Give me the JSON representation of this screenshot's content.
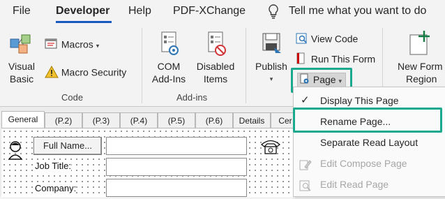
{
  "tabs": {
    "file": "File",
    "developer": "Developer",
    "help": "Help",
    "pdfxchange": "PDF-XChange",
    "tell_me": "Tell me what you want to do"
  },
  "ribbon": {
    "code": {
      "visual_basic": [
        "Visual",
        "Basic"
      ],
      "macros": "Macros",
      "macro_security": "Macro Security",
      "group_label": "Code"
    },
    "addins": {
      "com_addins": [
        "COM",
        "Add-Ins"
      ],
      "disabled_items": [
        "Disabled",
        "Items"
      ],
      "group_label": "Add-ins"
    },
    "custom_form": {
      "publish": "Publish",
      "view_code": "View Code",
      "run_this_form": "Run This Form",
      "page": "Page"
    },
    "new_form_region": [
      "New Form",
      "Region"
    ]
  },
  "page_menu": {
    "items": [
      {
        "label": "Display This Page",
        "checked": true,
        "enabled": true
      },
      {
        "label": "Rename Page...",
        "checked": false,
        "enabled": true
      },
      {
        "label": "Separate Read Layout",
        "checked": false,
        "enabled": true
      },
      {
        "label": "Edit Compose Page",
        "checked": false,
        "enabled": false
      },
      {
        "label": "Edit Read Page",
        "checked": false,
        "enabled": false
      }
    ]
  },
  "form_tabs": [
    "General",
    "(P.2)",
    "(P.3)",
    "(P.4)",
    "(P.5)",
    "(P.6)",
    "Details",
    "Cer"
  ],
  "form": {
    "full_name_button": "Full Name...",
    "job_title_label": "Job Title:",
    "company_label": "Company:"
  },
  "colors": {
    "accent_blue": "#185abd",
    "highlight_teal": "#1aa88e"
  }
}
